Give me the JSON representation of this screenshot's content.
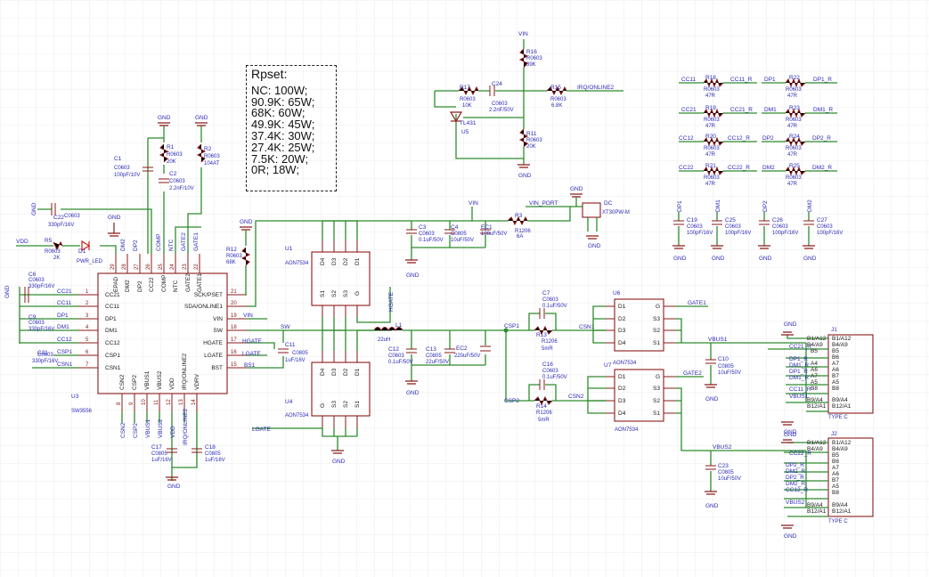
{
  "rpset": {
    "title": "Rpset:",
    "lines": [
      "NC: 100W;",
      "90.9K: 65W;",
      "68K: 60W;",
      "49.9K: 45W;",
      "37.4K: 30W;",
      "27.4K: 25W;",
      "7.5K: 20W;",
      "0R; 18W;"
    ]
  },
  "parts": {
    "u3": {
      "ref": "U3",
      "value": "SW3556"
    },
    "u1": {
      "ref": "U1",
      "value": "AON7534"
    },
    "u4": {
      "ref": "U4",
      "value": "AON7534"
    },
    "u6": {
      "ref": "U6",
      "value": "AON7534"
    },
    "u7": {
      "ref": "U7",
      "value": "AON7534"
    },
    "u5": {
      "ref": "U5",
      "value": "TL431"
    },
    "dc": {
      "ref": "DC",
      "value": "XT30PW-M"
    },
    "j1": {
      "ref": "J1",
      "value": "TYPE C"
    },
    "j2": {
      "ref": "J2",
      "value": "TYPE C"
    },
    "l1": {
      "ref": "L1",
      "value": "22uH"
    },
    "d1": {
      "ref": "D1",
      "value": "PWR_LED"
    },
    "ec1": {
      "ref": "EC1",
      "value": "100uF/50V"
    },
    "ec2": {
      "ref": "EC2",
      "value": "220uF/50V"
    },
    "r1": {
      "ref": "R1",
      "pkg": "R0603",
      "value": "20K"
    },
    "r2": {
      "ref": "R2",
      "pkg": "R0603",
      "value": "104AT"
    },
    "r5": {
      "ref": "R5",
      "pkg": "R0603",
      "value": "2K"
    },
    "r12": {
      "ref": "R12",
      "pkg": "R0603",
      "value": "68K"
    },
    "r16": {
      "ref": "R16",
      "pkg": "R0603",
      "value": "39K"
    },
    "r17": {
      "ref": "R17",
      "pkg": "R0603",
      "value": "10K"
    },
    "r15": {
      "ref": "R15",
      "pkg": "R0603",
      "value": "6.8K"
    },
    "r11": {
      "ref": "R11",
      "pkg": "R0603",
      "value": "20K"
    },
    "r3": {
      "ref": "R3",
      "pkg": "R1206",
      "value": "6A"
    },
    "r13": {
      "ref": "R13",
      "pkg": "R1206",
      "value": "5mR"
    },
    "r14": {
      "ref": "R14",
      "pkg": "R1206",
      "value": "5mR"
    },
    "c1": {
      "ref": "C1",
      "pkg": "C0603",
      "value": "100pF/10V"
    },
    "c2": {
      "ref": "C2",
      "pkg": "C0603",
      "value": "2.2nF/10V"
    },
    "c22": {
      "ref": "C22",
      "pkg": "C0603",
      "value": "330pF/16V"
    },
    "c6": {
      "ref": "C6",
      "pkg": "C0603",
      "value": "330pF/16V"
    },
    "c9": {
      "ref": "C9",
      "pkg": "C0603",
      "value": "330pF/16V"
    },
    "c21": {
      "ref": "C21",
      "pkg": "C0603",
      "value": "330pF/16V"
    },
    "c24": {
      "ref": "C24",
      "pkg": "C0603",
      "value": "2.2nF/50V"
    },
    "c3": {
      "ref": "C3",
      "pkg": "C0603",
      "value": "0.1uF/50V"
    },
    "c4": {
      "ref": "C4",
      "pkg": "C0805",
      "value": "10uF/50V"
    },
    "c11": {
      "ref": "C11",
      "pkg": "C0805",
      "value": "1uF/16V"
    },
    "c12": {
      "ref": "C12",
      "pkg": "C0603",
      "value": "0.1uF/50V"
    },
    "c13": {
      "ref": "C13",
      "pkg": "C0805",
      "value": "22uF/50V"
    },
    "c7": {
      "ref": "C7",
      "pkg": "C0603",
      "value": "0.1uF/50V"
    },
    "c16": {
      "ref": "C16",
      "pkg": "C0603",
      "value": "0.1uF/50V"
    },
    "c10": {
      "ref": "C10",
      "pkg": "C0805",
      "value": "10uF/50V"
    },
    "c23": {
      "ref": "C23",
      "pkg": "C0805",
      "value": "10uF/50V"
    },
    "c17": {
      "ref": "C17",
      "pkg": "C0805",
      "value": "1uF/16V"
    },
    "c18": {
      "ref": "C18",
      "pkg": "C0805",
      "value": "1uF/16V"
    },
    "c19": {
      "ref": "C19",
      "pkg": "C0603",
      "value": "100pF/16V"
    },
    "c25": {
      "ref": "C25",
      "pkg": "C0603",
      "value": "100pF/16V"
    },
    "c26": {
      "ref": "C26",
      "pkg": "C0603",
      "value": "100pF/16V"
    },
    "c27": {
      "ref": "C27",
      "pkg": "C0603",
      "value": "100pF/16V"
    }
  },
  "nets": {
    "gnd": "GND",
    "vin": "VIN",
    "vdd": "VDD",
    "vin_port": "VIN_PORT",
    "sw": "SW",
    "csp1": "CSP1",
    "csp2": "CSP2",
    "csn1": "CSN1",
    "csn2": "CSN2",
    "gate1": "GATE1",
    "gate2": "GATE2",
    "vbus1": "VBUS1",
    "vbus2": "VBUS2",
    "hgate": "HGATE",
    "lgate": "LGATE",
    "bs1": "BS1",
    "irq": "IRQ/ONLINE2",
    "cc11": "CC11",
    "cc21": "CC21",
    "cc12": "CC12",
    "cc22": "CC22",
    "dp1": "DP1",
    "dm1": "DM1",
    "dp2": "DP2",
    "dm2": "DM2",
    "cc11r": "CC11_R",
    "cc21r": "CC21_R",
    "cc12r": "CC12_R",
    "cc22r": "CC22_R",
    "dp1r": "DP1_R",
    "dm1r": "DM1_R",
    "dp2r": "DP2_R",
    "dm2r": "DM2_R",
    "comp": "COMP",
    "ntc": "NTC"
  },
  "u3_pins_left": [
    [
      "CC21",
      "1"
    ],
    [
      "CC11",
      "2"
    ],
    [
      "DP1",
      "3"
    ],
    [
      "DM1",
      "4"
    ],
    [
      "CC12",
      "5"
    ],
    [
      "CSP1",
      "6"
    ],
    [
      "CSN1",
      "7"
    ]
  ],
  "u3_pins_right": [
    [
      "SCK/PSET",
      "21"
    ],
    [
      "SDA/ONLINE1",
      "20"
    ],
    [
      "VIN",
      "19"
    ],
    [
      "SW",
      "18"
    ],
    [
      "HGATE",
      "17"
    ],
    [
      "LGATE",
      "16"
    ],
    [
      "BST",
      "15"
    ]
  ],
  "u3_pins_top": [
    [
      "EPAD",
      "29"
    ],
    [
      "DM2",
      "28"
    ],
    [
      "DP2",
      "27"
    ],
    [
      "CC22",
      "26"
    ],
    [
      "COMP",
      "25"
    ],
    [
      "NTC",
      "24"
    ],
    [
      "GATE2",
      "23"
    ],
    [
      "GATE1",
      "22"
    ]
  ],
  "u3_pins_bottom": [
    [
      "CSN2",
      "8"
    ],
    [
      "CSP2",
      "9"
    ],
    [
      "VBUS1",
      "10"
    ],
    [
      "VBUS2",
      "11"
    ],
    [
      "VDD",
      "12"
    ],
    [
      "IRQ/ONLINE2",
      "13"
    ],
    [
      "VDRV",
      "14"
    ]
  ],
  "mos_pins": [
    "D4",
    "D3",
    "D2",
    "D1",
    "S1",
    "S2",
    "S3",
    "G"
  ],
  "typec_pins_left": [
    "B1/A12",
    "B4/A9",
    "B5",
    "A4",
    "A6",
    "A7",
    "A5",
    "B8",
    "B9/A4",
    "B12/A1"
  ],
  "typec_pins_right": [
    "B1/A12",
    "B4/A9",
    "B5",
    "B6",
    "A7",
    "A6",
    "B7",
    "A5",
    "B8",
    "B9/A4",
    "B12/A1"
  ],
  "j1_nets": [
    "CC21_R",
    "DP1_R",
    "DM1_R",
    "DP1_R",
    "DM1_R",
    "CC11_R",
    "VBUS1"
  ],
  "j2_nets": [
    "CC22_R",
    "DP2_R",
    "DM2_R",
    "DP2_R",
    "DM2_R",
    "CC12_R",
    "VBUS2"
  ],
  "usb_res": [
    {
      "ref": "R18",
      "pkg": "R0603",
      "value": "47R",
      "in": "CC11",
      "out": "CC11_R"
    },
    {
      "ref": "R19",
      "pkg": "R0603",
      "value": "47R",
      "in": "CC21",
      "out": "CC21_R"
    },
    {
      "ref": "R20",
      "pkg": "R0603",
      "value": "47R",
      "in": "CC12",
      "out": "CC12_R"
    },
    {
      "ref": "R21",
      "pkg": "R0603",
      "value": "47R",
      "in": "CC22",
      "out": "CC22_R"
    },
    {
      "ref": "R22",
      "pkg": "R0603",
      "value": "47R",
      "in": "DP1",
      "out": "DP1_R"
    },
    {
      "ref": "R23",
      "pkg": "R0603",
      "value": "47R",
      "in": "DM1",
      "out": "DM1_R"
    },
    {
      "ref": "R24",
      "pkg": "R0603",
      "value": "47R",
      "in": "DP2",
      "out": "DP2_R"
    },
    {
      "ref": "R25",
      "pkg": "R0603",
      "value": "47R",
      "in": "DM2",
      "out": "DM2_R"
    }
  ]
}
